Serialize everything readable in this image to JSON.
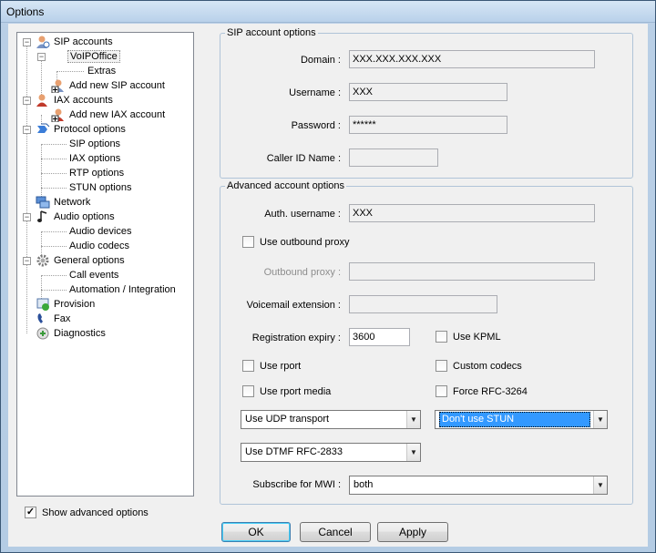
{
  "window": {
    "title": "Options"
  },
  "tree": {
    "nodes": [
      {
        "label": "SIP accounts",
        "icon": "sip-accounts-icon"
      },
      {
        "label": "VoIPOffice"
      },
      {
        "label": "Extras"
      },
      {
        "label": "Add new SIP account",
        "icon": "add-account-icon"
      },
      {
        "label": "IAX accounts",
        "icon": "iax-accounts-icon"
      },
      {
        "label": "Add new IAX account",
        "icon": "add-account-icon"
      },
      {
        "label": "Protocol options",
        "icon": "protocol-icon"
      },
      {
        "label": "SIP options"
      },
      {
        "label": "IAX options"
      },
      {
        "label": "RTP options"
      },
      {
        "label": "STUN options"
      },
      {
        "label": "Network",
        "icon": "network-icon"
      },
      {
        "label": "Audio options",
        "icon": "audio-icon"
      },
      {
        "label": "Audio devices"
      },
      {
        "label": "Audio codecs"
      },
      {
        "label": "General options",
        "icon": "gear-icon"
      },
      {
        "label": "Call events"
      },
      {
        "label": "Automation / Integration"
      },
      {
        "label": "Provision",
        "icon": "provision-icon"
      },
      {
        "label": "Fax",
        "icon": "fax-icon"
      },
      {
        "label": "Diagnostics",
        "icon": "diagnostics-icon"
      }
    ]
  },
  "show_advanced": {
    "label": "Show advanced options",
    "checked": true
  },
  "sip_account": {
    "title": "SIP account options",
    "domain_label": "Domain :",
    "domain_value": "XXX.XXX.XXX.XXX",
    "username_label": "Username :",
    "username_value": "XXX",
    "password_label": "Password :",
    "password_value": "******",
    "callerid_label": "Caller ID Name :",
    "callerid_value": ""
  },
  "advanced": {
    "title": "Advanced account options",
    "auth_label": "Auth. username :",
    "auth_value": "XXX",
    "outbound_proxy_checkbox": "Use outbound proxy",
    "outbound_proxy_label": "Outbound proxy :",
    "outbound_proxy_value": "",
    "voicemail_label": "Voicemail extension :",
    "voicemail_value": "",
    "reg_expiry_label": "Registration expiry :",
    "reg_expiry_value": "3600",
    "use_kpml": "Use KPML",
    "use_rport": "Use rport",
    "custom_codecs": "Custom codecs",
    "use_rport_media": "Use rport media",
    "force_rfc": "Force RFC-3264",
    "transport_value": "Use UDP transport",
    "stun_value": "Don't use STUN",
    "dtmf_value": "Use DTMF RFC-2833",
    "mwi_label": "Subscribe for MWI :",
    "mwi_value": "both"
  },
  "buttons": {
    "ok": "OK",
    "cancel": "Cancel",
    "apply": "Apply"
  }
}
